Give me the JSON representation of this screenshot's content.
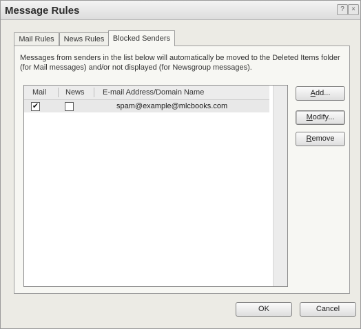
{
  "window": {
    "title": "Message Rules",
    "help_glyph": "?",
    "close_glyph": "×"
  },
  "tabs": [
    {
      "label": "Mail Rules",
      "active": false
    },
    {
      "label": "News Rules",
      "active": false
    },
    {
      "label": "Blocked Senders",
      "active": true
    }
  ],
  "description": "Messages from senders in the list below will automatically be moved to the Deleted Items folder (for Mail messages) and/or not displayed (for Newsgroup messages).",
  "list": {
    "columns": [
      "Mail",
      "News",
      "E-mail Address/Domain Name"
    ],
    "rows": [
      {
        "mail_checked": true,
        "news_checked": false,
        "address": "spam@example@mlcbooks.com"
      }
    ]
  },
  "side_buttons": {
    "add": {
      "underline": "A",
      "rest": "dd..."
    },
    "modify": {
      "underline": "M",
      "rest": "odify..."
    },
    "remove": {
      "underline": "R",
      "rest": "emove"
    }
  },
  "footer_buttons": {
    "ok": "OK",
    "cancel": "Cancel"
  },
  "icons": {
    "checked": "✔",
    "unchecked": ""
  }
}
